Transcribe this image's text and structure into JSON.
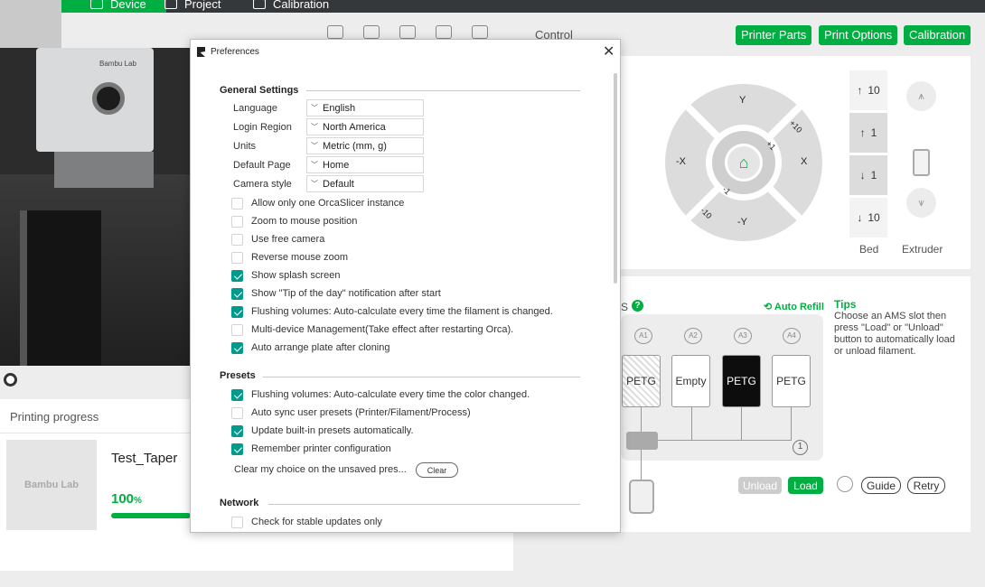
{
  "tabs": {
    "device": "Device",
    "project": "Project",
    "calibration": "Calibration"
  },
  "progress": {
    "header": "Printing progress",
    "job_name": "Test_Taper",
    "percent": "100",
    "percent_unit": "%",
    "thumb_text": "Bambu Lab"
  },
  "camera": {
    "brand_text": "Bambu Lab"
  },
  "control": {
    "label": "Control",
    "buttons": {
      "printer_parts": "Printer Parts",
      "print_options": "Print Options",
      "calibration": "Calibration"
    },
    "jog": {
      "y": "Y",
      "neg_y": "-Y",
      "x": "X",
      "neg_x": "-X",
      "p10": "+10",
      "p1": "+1",
      "m1": "-1",
      "m10": "-10"
    },
    "bed": {
      "up10": "10",
      "up1": "1",
      "down1": "1",
      "down10": "10",
      "label": "Bed"
    },
    "extruder": {
      "label": "Extruder"
    }
  },
  "ams": {
    "label": "S",
    "auto_refill": "Auto Refill",
    "tips_title": "Tips",
    "tips_text": "Choose an AMS slot then press \"Load\" or \"Unload\" button to automatically load or unload filament.",
    "slots": [
      {
        "num": "A1",
        "label": "PETG"
      },
      {
        "num": "A2",
        "label": "Empty"
      },
      {
        "num": "A3",
        "label": "PETG"
      },
      {
        "num": "A4",
        "label": "PETG"
      }
    ],
    "hub_num": "1",
    "unload": "Unload",
    "load": "Load",
    "guide": "Guide",
    "retry": "Retry"
  },
  "dialog": {
    "title": "Preferences",
    "general": {
      "heading": "General Settings",
      "language": {
        "label": "Language",
        "value": "English"
      },
      "login_region": {
        "label": "Login Region",
        "value": "North America"
      },
      "units": {
        "label": "Units",
        "value": "Metric (mm, g)"
      },
      "default_page": {
        "label": "Default Page",
        "value": "Home"
      },
      "camera_style": {
        "label": "Camera style",
        "value": "Default"
      },
      "checks": [
        {
          "label": "Allow only one OrcaSlicer instance",
          "checked": false
        },
        {
          "label": "Zoom to mouse position",
          "checked": false
        },
        {
          "label": "Use free camera",
          "checked": false
        },
        {
          "label": "Reverse mouse zoom",
          "checked": false
        },
        {
          "label": "Show splash screen",
          "checked": true
        },
        {
          "label": "Show \"Tip of the day\" notification after start",
          "checked": true
        },
        {
          "label": "Flushing volumes: Auto-calculate every time the filament is changed.",
          "checked": true
        },
        {
          "label": "Multi-device Management(Take effect after restarting Orca).",
          "checked": false
        },
        {
          "label": "Auto arrange plate after cloning",
          "checked": true
        }
      ]
    },
    "presets": {
      "heading": "Presets",
      "checks": [
        {
          "label": "Flushing volumes: Auto-calculate every time the color changed.",
          "checked": true
        },
        {
          "label": "Auto sync user presets (Printer/Filament/Process)",
          "checked": false
        },
        {
          "label": "Update built-in presets automatically.",
          "checked": true
        },
        {
          "label": "Remember printer configuration",
          "checked": true
        }
      ],
      "clear_text": "Clear my choice on the unsaved pres...",
      "clear_button": "Clear"
    },
    "network": {
      "heading": "Network",
      "checks": [
        {
          "label": "Check for stable updates only",
          "checked": false
        }
      ]
    }
  }
}
